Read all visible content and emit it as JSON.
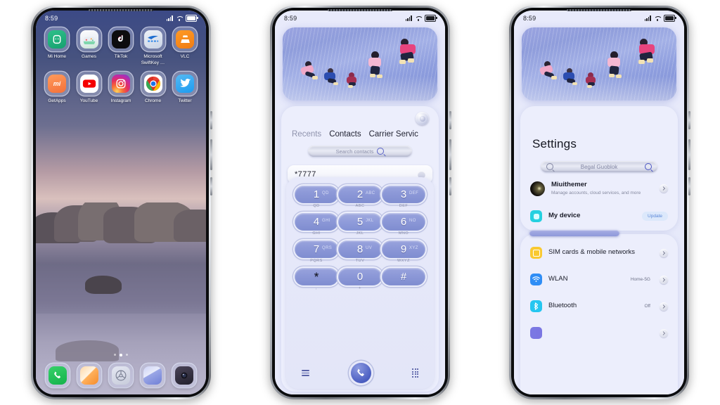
{
  "status_bar": {
    "time": "8:59",
    "signal_icon": "signal-bars-icon",
    "wifi_icon": "wifi-icon",
    "battery_icon": "battery-icon"
  },
  "phone1": {
    "name": "home-screen",
    "app_rows": [
      [
        {
          "label": "Mi Home",
          "icon": "mi-home-icon"
        },
        {
          "label": "Games",
          "icon": "games-icon"
        },
        {
          "label": "TikTok",
          "icon": "tiktok-icon"
        },
        {
          "label": "Microsoft SwiftKey …",
          "icon": "swiftkey-icon"
        },
        {
          "label": "VLC",
          "icon": "vlc-icon"
        }
      ],
      [
        {
          "label": "GetApps",
          "icon": "getapps-icon"
        },
        {
          "label": "YouTube",
          "icon": "youtube-icon"
        },
        {
          "label": "Instagram",
          "icon": "instagram-icon"
        },
        {
          "label": "Chrome",
          "icon": "chrome-icon"
        },
        {
          "label": "Twitter",
          "icon": "twitter-icon"
        }
      ]
    ],
    "page_dots": {
      "count": 3,
      "active_index": 1
    },
    "dock": [
      {
        "label": "Phone",
        "icon": "phone-icon"
      },
      {
        "label": "Messages",
        "icon": "messages-icon"
      },
      {
        "label": "Browser",
        "icon": "browser-icon"
      },
      {
        "label": "Gallery",
        "icon": "gallery-icon"
      },
      {
        "label": "Camera",
        "icon": "camera-icon"
      }
    ]
  },
  "phone2": {
    "name": "dialer-screen",
    "hero_image": "kids-jumping-in-rain-illustration",
    "avatar_button": "account-avatar-icon",
    "tabs": [
      {
        "label": "Recents",
        "active": false
      },
      {
        "label": "Contacts",
        "active": true
      },
      {
        "label": "Carrier Servic",
        "active": false
      }
    ],
    "search": {
      "placeholder": "Search contacts",
      "icon": "search-icon"
    },
    "dial_input": {
      "value": "*7777",
      "clear_icon": "backspace-icon"
    },
    "keypad": [
      {
        "digit": "1",
        "sub": "QD",
        "letters": "QD"
      },
      {
        "digit": "2",
        "sub": "ABC",
        "letters": "ABC"
      },
      {
        "digit": "3",
        "sub": "DEF",
        "letters": "DEF"
      },
      {
        "digit": "4",
        "sub": "GHI",
        "letters": "GHI"
      },
      {
        "digit": "5",
        "sub": "JKL",
        "letters": "JKL"
      },
      {
        "digit": "6",
        "sub": "MNO",
        "letters": "NO"
      },
      {
        "digit": "7",
        "sub": "PQRS",
        "letters": "QRS"
      },
      {
        "digit": "8",
        "sub": "TUV",
        "letters": "UV"
      },
      {
        "digit": "9",
        "sub": "WXYZ",
        "letters": "XYZ"
      },
      {
        "digit": "*",
        "sub": ",",
        "letters": ""
      },
      {
        "digit": "0",
        "sub": "+",
        "letters": ""
      },
      {
        "digit": "#",
        "sub": "",
        "letters": ""
      }
    ],
    "bottom_bar": {
      "menu_icon": "menu-icon",
      "call_icon": "call-icon",
      "keypad_icon": "keypad-icon"
    }
  },
  "phone3": {
    "name": "settings-screen",
    "hero_image": "kids-jumping-in-rain-illustration",
    "title": "Settings",
    "search": {
      "placeholder": "Begal Guoblok",
      "icon": "search-icon"
    },
    "account": {
      "name": "Miuithemer",
      "subtitle": "Manage accounts, cloud services, and more",
      "avatar": "profile-avatar"
    },
    "items": [
      {
        "label": "My device",
        "value": "",
        "badge": "Update",
        "icon": "device-icon",
        "color": "#25d0e0"
      },
      {
        "label": "SIM cards & mobile networks",
        "value": "",
        "badge": "",
        "icon": "sim-card-icon",
        "color": "#f6c game"
      },
      {
        "label": "WLAN",
        "value": "Home-5G",
        "badge": "",
        "icon": "wifi-icon",
        "color": "#2f8df5"
      },
      {
        "label": "Bluetooth",
        "value": "Off",
        "badge": "",
        "icon": "bluetooth-icon",
        "color": "#25c6f0"
      }
    ],
    "item_colors": [
      "#25d0e0",
      "#f9c931",
      "#2f8df5",
      "#25c6f0",
      "#6f6ae0"
    ]
  },
  "colors": {
    "accent": "#5b63a8",
    "key_blue": "#8d99d8",
    "panel_bg": "#eceefc",
    "theme_bg": "#e8eafb",
    "update_pill_bg": "#dce8fb",
    "update_pill_text": "#5b87d8"
  }
}
